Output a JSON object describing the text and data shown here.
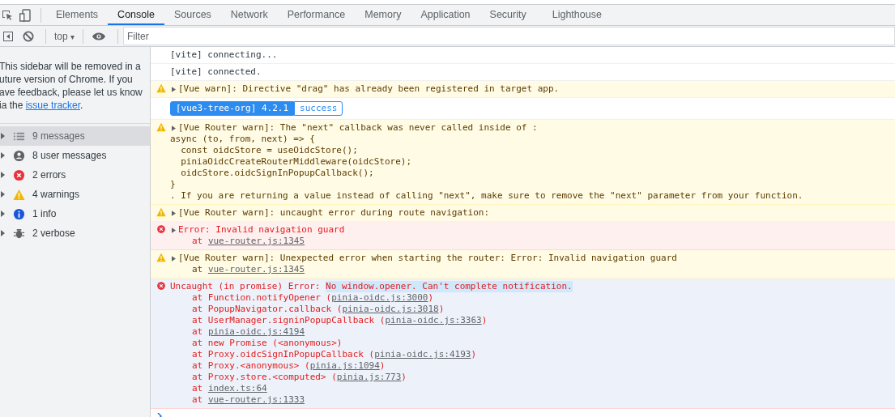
{
  "tabs": [
    {
      "label": "Elements",
      "selected": false
    },
    {
      "label": "Console",
      "selected": true
    },
    {
      "label": "Sources",
      "selected": false
    },
    {
      "label": "Network",
      "selected": false
    },
    {
      "label": "Performance",
      "selected": false
    },
    {
      "label": "Memory",
      "selected": false
    },
    {
      "label": "Application",
      "selected": false
    },
    {
      "label": "Security",
      "selected": false
    },
    {
      "label": "Lighthouse",
      "selected": false
    }
  ],
  "toolbar": {
    "context": "top",
    "context_caret": "▾",
    "filter_placeholder": "Filter"
  },
  "sidebar": {
    "notice_lines": [
      "This sidebar will be removed in a",
      "uture version of Chrome. If you",
      "ave feedback, please let us know"
    ],
    "notice_last": "ia the ",
    "notice_link": "issue tracker",
    "notice_end": ".",
    "items": [
      {
        "label": "9 messages",
        "kind": "all",
        "selected": true
      },
      {
        "label": "8 user messages",
        "kind": "user",
        "selected": false
      },
      {
        "label": "2 errors",
        "kind": "error",
        "selected": false
      },
      {
        "label": "4 warnings",
        "kind": "warning",
        "selected": false
      },
      {
        "label": "1 info",
        "kind": "info",
        "selected": false
      },
      {
        "label": "2 verbose",
        "kind": "verbose",
        "selected": false
      }
    ]
  },
  "messages": [
    {
      "kind": "log",
      "expandable": false,
      "selected": false,
      "lines": [
        "[vite] connecting..."
      ]
    },
    {
      "kind": "log",
      "expandable": false,
      "selected": false,
      "lines": [
        "[vite] connected."
      ]
    },
    {
      "kind": "warn",
      "expandable": true,
      "selected": false,
      "lines": [
        "[Vue warn]: Directive \"drag\" has already been registered in target app."
      ]
    },
    {
      "kind": "badge",
      "expandable": false,
      "selected": false,
      "label": "[vue3-tree-org] 4.2.1",
      "status": "success"
    },
    {
      "kind": "warn",
      "expandable": true,
      "selected": false,
      "lines": [
        "[Vue Router warn]: The \"next\" callback was never called inside of :",
        "async (to, from, next) => {",
        "  const oidcStore = useOidcStore();",
        "  piniaOidcCreateRouterMiddleware(oidcStore);",
        "  oidcStore.oidcSignInPopupCallback();",
        "}",
        ". If you are returning a value instead of calling \"next\", make sure to remove the \"next\" parameter from your function."
      ]
    },
    {
      "kind": "warn",
      "expandable": true,
      "selected": false,
      "lines": [
        "[Vue Router warn]: uncaught error during route navigation:"
      ]
    },
    {
      "kind": "error",
      "expandable": true,
      "selected": false,
      "lines": [
        "Error: Invalid navigation guard"
      ],
      "stack": [
        {
          "pre": "at ",
          "link": "vue-router.js:1345"
        }
      ]
    },
    {
      "kind": "warn",
      "expandable": true,
      "selected": false,
      "lines": [
        "[Vue Router warn]: Unexpected error when starting the router: Error: Invalid navigation guard"
      ],
      "stack": [
        {
          "pre": "at ",
          "link": "vue-router.js:1345"
        }
      ]
    },
    {
      "kind": "error",
      "expandable": false,
      "selected": true,
      "lines": [
        "Uncaught (in promise) Error: "
      ],
      "highlight": "No window.opener. Can't complete notification.",
      "stack": [
        {
          "pre": "at Function.notifyOpener (",
          "link": "pinia-oidc.js:3000",
          "post": ")"
        },
        {
          "pre": "at PopupNavigator.callback (",
          "link": "pinia-oidc.js:3018",
          "post": ")"
        },
        {
          "pre": "at UserManager.signinPopupCallback (",
          "link": "pinia-oidc.js:3363",
          "post": ")"
        },
        {
          "pre": "at ",
          "link": "pinia-oidc.js:4194"
        },
        {
          "pre": "at new Promise (<anonymous>)"
        },
        {
          "pre": "at Proxy.oidcSignInPopupCallback (",
          "link": "pinia-oidc.js:4193",
          "post": ")"
        },
        {
          "pre": "at Proxy.<anonymous> (",
          "link": "pinia.js:1094",
          "post": ")"
        },
        {
          "pre": "at Proxy.store.<computed> (",
          "link": "pinia.js:773",
          "post": ")"
        },
        {
          "pre": "at ",
          "link": "index.ts:64"
        },
        {
          "pre": "at ",
          "link": "vue-router.js:1333"
        }
      ]
    }
  ]
}
